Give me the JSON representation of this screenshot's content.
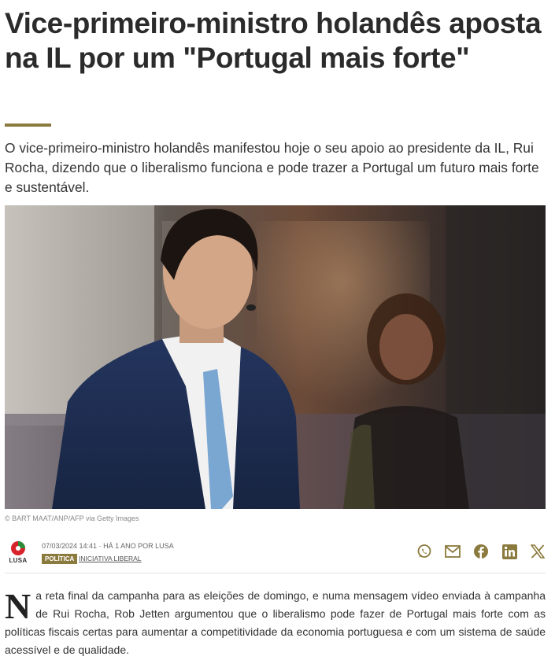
{
  "article": {
    "headline": "Vice-primeiro-ministro holandês aposta na IL por um \"Portugal mais forte\"",
    "lead": "O vice-primeiro-ministro holandês manifestou hoje o seu apoio ao presidente da IL, Rui Rocha, dizendo que o liberalismo funciona e pode trazer a Portugal um futuro mais forte e sustentável.",
    "photo_credit": "© BART MAAT/ANP/AFP via Getty Images",
    "agency": "LUSA",
    "meta_line": "07/03/2024 14:41 · HÁ 1 ANO POR LUSA",
    "category": "POLÍTICA",
    "subcategory": "INICIATIVA LIBERAL",
    "dropcap": "N",
    "body_rest": "a reta final da campanha para as eleições de domingo, e numa mensagem vídeo enviada à campanha de Rui Rocha, Rob Jetten argumentou que o liberalismo pode fazer de Portugal mais forte com as políticas fiscais certas para aumentar a competitividade da economia portuguesa e com um sistema de saúde acessível e de qualidade."
  },
  "share": {
    "icons": [
      "whatsapp-icon",
      "email-icon",
      "facebook-icon",
      "linkedin-icon",
      "x-icon"
    ],
    "color": "#8b7a3e"
  },
  "colors": {
    "accent": "#8b7a3e",
    "headline": "#2b2b2b",
    "lusa_red": "#d8232a",
    "lusa_green": "#2e8b3a"
  }
}
